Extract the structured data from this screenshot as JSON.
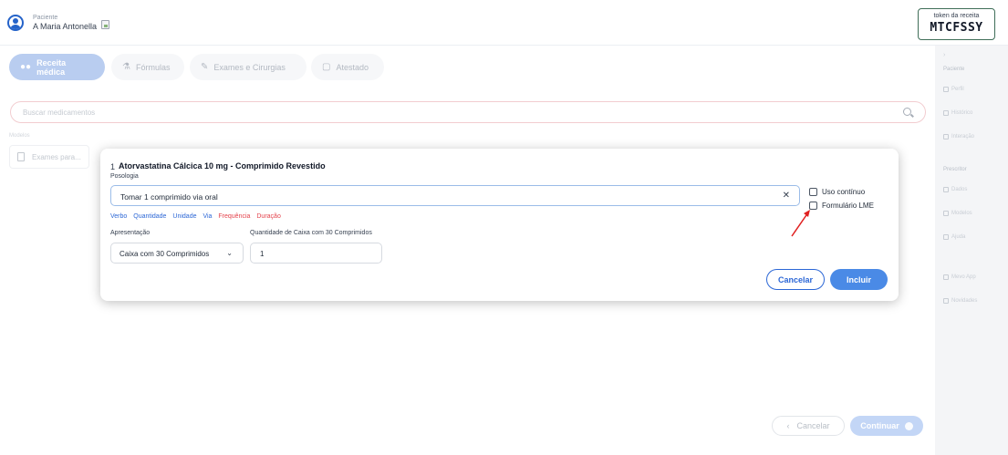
{
  "header": {
    "patient_label": "Paciente",
    "patient_name": "A Maria Antonella",
    "token_label": "token da receita",
    "token_value": "MTCFSSY"
  },
  "tabs": [
    {
      "label": "Receita médica",
      "icon": "pills-icon",
      "active": true
    },
    {
      "label": "Fórmulas",
      "icon": "flask-icon",
      "active": false
    },
    {
      "label": "Exames e Cirurgias",
      "icon": "pencil-icon",
      "active": false
    },
    {
      "label": "Atestado",
      "icon": "document-plus-icon",
      "active": false
    }
  ],
  "search": {
    "placeholder": "Buscar medicamentos"
  },
  "models": {
    "label": "Modelos",
    "items": [
      {
        "label": "Exames para..."
      }
    ]
  },
  "sidebar": {
    "sections": [
      {
        "title": "Paciente",
        "items": [
          "Perfil",
          "Histórico",
          "Interação"
        ]
      },
      {
        "title": "Prescritor",
        "items": [
          "Dados",
          "Modelos",
          "Ajuda"
        ]
      },
      {
        "title": "",
        "items": [
          "Mevo App",
          "Novidades"
        ]
      }
    ]
  },
  "footer": {
    "back_label": "Cancelar",
    "continue_label": "Continuar"
  },
  "modal": {
    "index": "1",
    "med_title": "Atorvastatina Cálcica 10 mg - Comprimido Revestido",
    "posologia_label": "Posologia",
    "dose_value": "Tomar 1 comprimido via oral",
    "chips": [
      {
        "label": "Verbo",
        "color": "#2c67d6"
      },
      {
        "label": "Quantidade",
        "color": "#2c67d6"
      },
      {
        "label": "Unidade",
        "color": "#2c67d6"
      },
      {
        "label": "Via",
        "color": "#2c67d6"
      },
      {
        "label": "Frequência",
        "color": "#e4424b"
      },
      {
        "label": "Duração",
        "color": "#e4424b"
      }
    ],
    "apresentacao_label": "Apresentação",
    "apresentacao_value": "Caixa com 30 Comprimidos",
    "qty_label": "Quantidade de Caixa com 30 Comprimidos",
    "qty_value": "1",
    "checkbox_continuous": "Uso contínuo",
    "checkbox_lme": "Formulário LME",
    "cancel_label": "Cancelar",
    "include_label": "Incluir"
  },
  "colors": {
    "primary": "#4a8ae6",
    "accent_red": "#e4424b",
    "annotation_arrow": "#e02020"
  }
}
